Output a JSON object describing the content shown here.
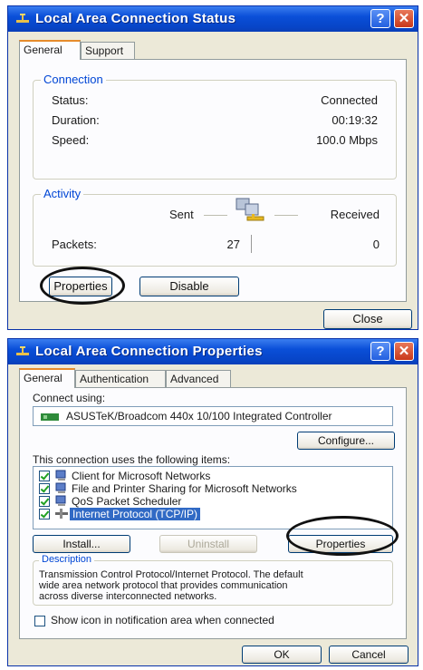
{
  "status_window": {
    "title": "Local Area Connection Status",
    "tabs": [
      {
        "label": "General"
      },
      {
        "label": "Support"
      }
    ],
    "connection": {
      "label": "Connection",
      "status_label": "Status:",
      "status_value": "Connected",
      "duration_label": "Duration:",
      "duration_value": "00:19:32",
      "speed_label": "Speed:",
      "speed_value": "100.0 Mbps"
    },
    "activity": {
      "label": "Activity",
      "sent_label": "Sent",
      "received_label": "Received",
      "packets_label": "Packets:",
      "packets_sent": "27",
      "packets_received": "0"
    },
    "buttons": {
      "properties": "Properties",
      "disable": "Disable",
      "close": "Close"
    }
  },
  "properties_window": {
    "title": "Local Area Connection Properties",
    "tabs": [
      {
        "label": "General"
      },
      {
        "label": "Authentication"
      },
      {
        "label": "Advanced"
      }
    ],
    "connect_using_label": "Connect using:",
    "adapter_name": "ASUSTeK/Broadcom 440x 10/100 Integrated Controller",
    "configure_button": "Configure...",
    "items_label": "This connection uses the following items:",
    "items": [
      {
        "label": "Client for Microsoft Networks",
        "checked": true,
        "icon": "network-client-icon"
      },
      {
        "label": "File and Printer Sharing for Microsoft Networks",
        "checked": true,
        "icon": "file-printer-sharing-icon"
      },
      {
        "label": "QoS Packet Scheduler",
        "checked": true,
        "icon": "qos-scheduler-icon"
      },
      {
        "label": "Internet Protocol (TCP/IP)",
        "checked": true,
        "icon": "protocol-icon",
        "selected": true
      }
    ],
    "install_button": "Install...",
    "uninstall_button": "Uninstall",
    "properties_button": "Properties",
    "description_label": "Description",
    "description_text_1": "Transmission Control Protocol/Internet Protocol. The default",
    "description_text_2": "wide area network protocol that provides communication",
    "description_text_3": "across diverse interconnected networks.",
    "show_icon_label": "Show icon in notification area when connected",
    "show_icon_checked": false,
    "ok_button": "OK",
    "cancel_button": "Cancel"
  },
  "colors": {
    "titlebar": "#0a4fd8",
    "group_label": "#0046d5",
    "selection": "#316ac5",
    "annotation": "#111111"
  }
}
